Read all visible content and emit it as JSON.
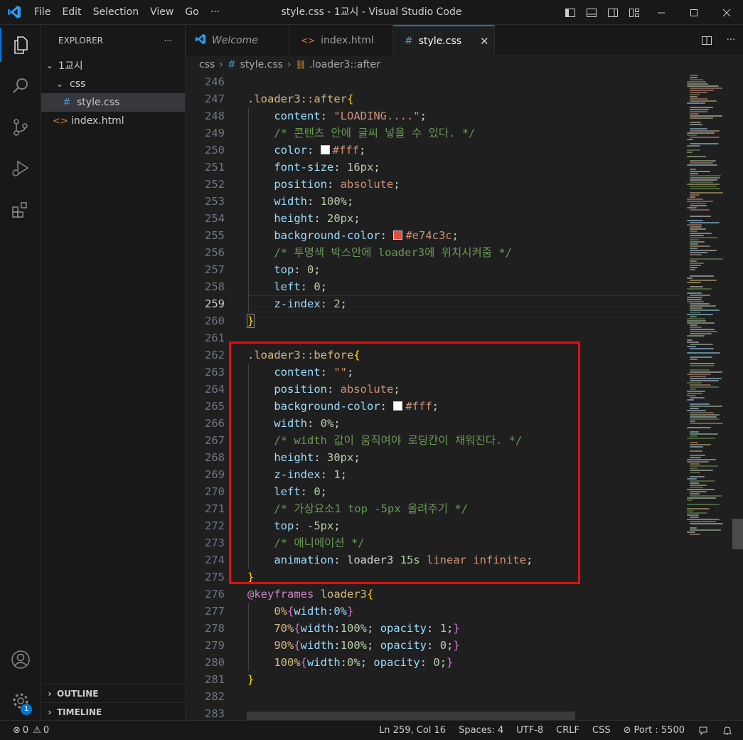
{
  "window_title": "style.css - 1교시 - Visual Studio Code",
  "menu": [
    "File",
    "Edit",
    "Selection",
    "View",
    "Go",
    "···"
  ],
  "activity": {
    "settings_badge": "1"
  },
  "explorer": {
    "title": "EXPLORER",
    "more": "···",
    "folder": "1교시",
    "subfolder": "css",
    "files": [
      "style.css",
      "index.html"
    ],
    "outline": "OUTLINE",
    "timeline": "TIMELINE"
  },
  "tabs": [
    {
      "label": "Welcome"
    },
    {
      "label": "index.html"
    },
    {
      "label": "style.css"
    }
  ],
  "breadcrumb": [
    "css",
    "style.css",
    ".loader3::after"
  ],
  "line_numbers": [
    "246",
    "247",
    "248",
    "249",
    "250",
    "251",
    "252",
    "253",
    "254",
    "255",
    "256",
    "257",
    "258",
    "259",
    "260",
    "261",
    "262",
    "263",
    "264",
    "265",
    "266",
    "267",
    "268",
    "269",
    "270",
    "271",
    "272",
    "273",
    "274",
    "275",
    "276",
    "277",
    "278",
    "279",
    "280",
    "281",
    "282",
    "283"
  ],
  "code": {
    "l247": {
      "sel": ".loader3::after",
      "br": "{"
    },
    "l248": {
      "prop": "content",
      "val": "\"LOADING....\""
    },
    "l249": "/* 콘텐츠 안에 글씨 넣을 수 있다. */",
    "l250": {
      "prop": "color",
      "val": "#fff"
    },
    "l251": {
      "prop": "font-size",
      "val": "16px"
    },
    "l252": {
      "prop": "position",
      "val": "absolute"
    },
    "l253": {
      "prop": "width",
      "val": "100%"
    },
    "l254": {
      "prop": "height",
      "val": "20px"
    },
    "l255": {
      "prop": "background-color",
      "val": "#e74c3c"
    },
    "l256": "/* 투명색 박스안에 loader3에 위치시켜줌 */",
    "l257": {
      "prop": "top",
      "val": "0"
    },
    "l258": {
      "prop": "left",
      "val": "0"
    },
    "l259": {
      "prop": "z-index",
      "val": "2"
    },
    "l260": "}",
    "l262": {
      "sel": ".loader3::before",
      "br": "{"
    },
    "l263": {
      "prop": "content",
      "val": "\"\""
    },
    "l264": {
      "prop": "position",
      "val": "absolute"
    },
    "l265": {
      "prop": "background-color",
      "val": "#fff"
    },
    "l266": {
      "prop": "width",
      "val": "0%"
    },
    "l267": "/* width 값이 움직여야 로딩칸이 채워진다. */",
    "l268": {
      "prop": "height",
      "val": "30px"
    },
    "l269": {
      "prop": "z-index",
      "val": "1"
    },
    "l270": {
      "prop": "left",
      "val": "0"
    },
    "l271": "/* 가상요소1 top -5px 올려주기 */",
    "l272": {
      "prop": "top",
      "val": "-5px"
    },
    "l273": "/* 애니메이션 */",
    "l274": {
      "prop": "animation",
      "val1": "loader3",
      "val2": "15s",
      "val3": "linear infinite"
    },
    "l275": "}",
    "l276": {
      "kw": "@keyframes",
      "name": "loader3",
      "br": "{"
    },
    "l277": {
      "pct": "0%",
      "body": "width:0%"
    },
    "l278": {
      "pct": "70%",
      "p1": "width",
      "v1": "100%",
      "p2": "opacity",
      "v2": "1"
    },
    "l279": {
      "pct": "90%",
      "p1": "width",
      "v1": "100%",
      "p2": "opacity",
      "v2": "0"
    },
    "l280": {
      "pct": "100%",
      "p1": "width",
      "v1": "0%",
      "p2": "opacity",
      "v2": "0"
    },
    "l281": "}"
  },
  "colors": {
    "swatch_white": "#ffffff",
    "swatch_red": "#e74c3c",
    "accent": "#0078d4",
    "highlight_box": "#e01010"
  },
  "status": {
    "errors": "0",
    "warnings": "0",
    "position": "Ln 259, Col 16",
    "spaces": "Spaces: 4",
    "encoding": "UTF-8",
    "eol": "CRLF",
    "language": "CSS",
    "port": "Port : 5500"
  }
}
